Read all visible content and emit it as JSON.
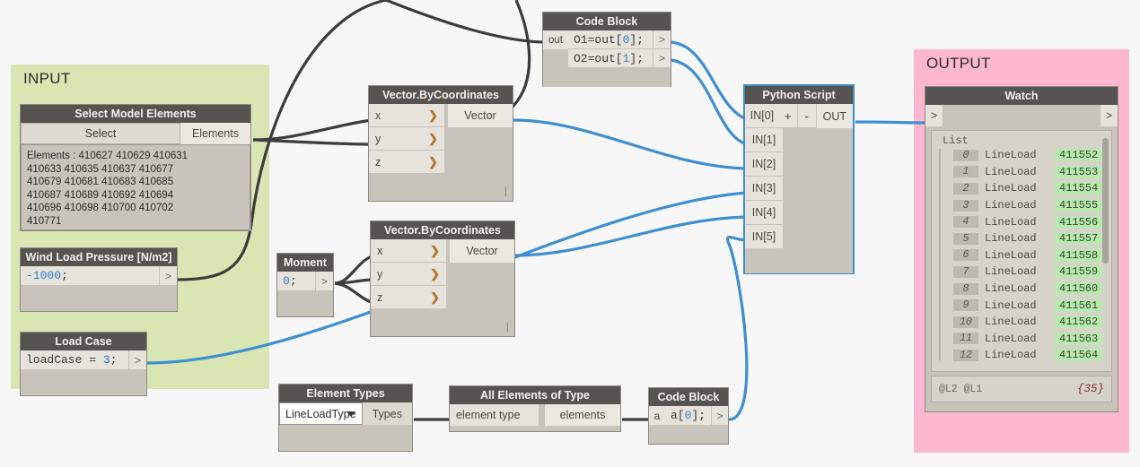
{
  "groups": {
    "input": {
      "title": "INPUT",
      "color": "#d9e6b4"
    },
    "output": {
      "title": "OUTPUT",
      "color": "#fdb8cf"
    }
  },
  "nodes": {
    "select_model_elements": {
      "title": "Select Model Elements",
      "button": "Select",
      "output_port": "Elements",
      "preview": "Elements : 410627 410629 410631\n410633 410635 410637 410677\n410679 410681 410683 410685\n410687 410689 410692 410694\n410696 410698 410700 410702\n410771"
    },
    "wind_load_pressure": {
      "title": "Wind Load Pressure [N/m2]",
      "code_value": "-1000",
      "code_tail": ";",
      "out_toggle": ">"
    },
    "load_case": {
      "title": "Load Case",
      "code_prefix": "loadCase = ",
      "code_value": "3",
      "code_tail": ";",
      "out_toggle": ">"
    },
    "vector_top": {
      "title": "Vector.ByCoordinates",
      "inputs": [
        "x",
        "y",
        "z"
      ],
      "output": "Vector"
    },
    "vector_bottom": {
      "title": "Vector.ByCoordinates",
      "inputs": [
        "x",
        "y",
        "z"
      ],
      "output": "Vector"
    },
    "moment": {
      "title": "Moment",
      "code_value": "0",
      "code_tail": ";",
      "out_toggle": ">"
    },
    "code_block_top": {
      "title": "Code Block",
      "input_port": "out",
      "line1_a": "O1=out[",
      "line1_idx": "0",
      "line1_b": "];",
      "line2_a": "O2=out[",
      "line2_idx": "1",
      "line2_b": "];",
      "toggle1": ">",
      "toggle2": ">"
    },
    "python_script": {
      "title": "Python Script",
      "inputs": [
        "IN[0]",
        "IN[1]",
        "IN[2]",
        "IN[3]",
        "IN[4]",
        "IN[5]"
      ],
      "add_button": "+",
      "remove_button": "-",
      "output": "OUT"
    },
    "element_types": {
      "title": "Element Types",
      "selected": "LineLoadType",
      "output": "Types"
    },
    "all_elements_of_type": {
      "title": "All Elements of Type",
      "input_port": "element type",
      "output": "elements"
    },
    "code_block_bottom": {
      "title": "Code Block",
      "input_port": "a",
      "code_a": "a[",
      "code_idx": "0",
      "code_b": "];",
      "toggle": ">"
    },
    "watch": {
      "title": "Watch",
      "in_toggle": ">",
      "out_toggle": ">",
      "list_label": "List",
      "items": [
        {
          "index": "0",
          "type": "LineLoad",
          "value": "411552"
        },
        {
          "index": "1",
          "type": "LineLoad",
          "value": "411553"
        },
        {
          "index": "2",
          "type": "LineLoad",
          "value": "411554"
        },
        {
          "index": "3",
          "type": "LineLoad",
          "value": "411555"
        },
        {
          "index": "4",
          "type": "LineLoad",
          "value": "411556"
        },
        {
          "index": "5",
          "type": "LineLoad",
          "value": "411557"
        },
        {
          "index": "6",
          "type": "LineLoad",
          "value": "411558"
        },
        {
          "index": "7",
          "type": "LineLoad",
          "value": "411559"
        },
        {
          "index": "8",
          "type": "LineLoad",
          "value": "411560"
        },
        {
          "index": "9",
          "type": "LineLoad",
          "value": "411561"
        },
        {
          "index": "10",
          "type": "LineLoad",
          "value": "411562"
        },
        {
          "index": "11",
          "type": "LineLoad",
          "value": "411563"
        },
        {
          "index": "12",
          "type": "LineLoad",
          "value": "411564"
        }
      ],
      "footer_levels": "@L2 @L1",
      "footer_count": "{35}"
    }
  },
  "colors": {
    "canvas": "#f7f7f7",
    "node_body": "#c8c4bb",
    "node_header": "#565451",
    "port": "#e6e3dc",
    "wire_grey": "#3c3c3c",
    "wire_blue": "#3e8ed0",
    "selection": "#3e8ed0",
    "value_highlight": "#b9e8b0",
    "group_input": "#d9e6b4",
    "group_output": "#fdb8cf"
  }
}
